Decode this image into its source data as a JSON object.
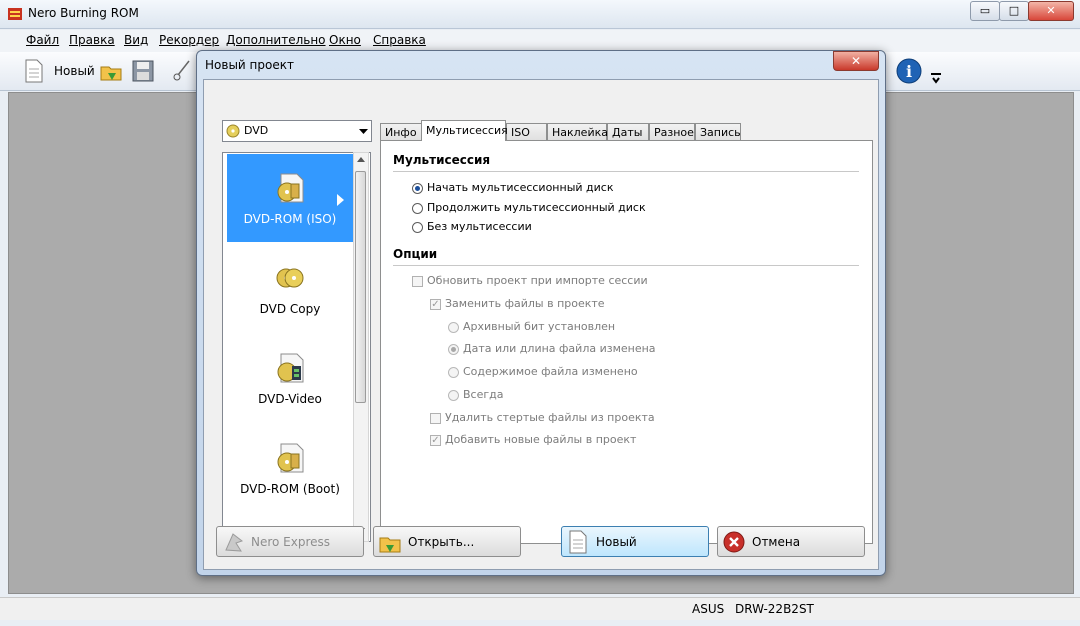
{
  "window": {
    "title": "Nero Burning ROM"
  },
  "window_controls": {
    "minimize": "▭",
    "maximize": "□",
    "close": "✕"
  },
  "menu": [
    "Файл",
    "Правка",
    "Вид",
    "Рекордер",
    "Дополнительно",
    "Окно",
    "Справка"
  ],
  "toolbar": {
    "new_label": "Новый",
    "info_icon": "i"
  },
  "statusbar": {
    "drive_vendor": "ASUS",
    "drive_model": "DRW-22B2ST"
  },
  "dialog": {
    "title": "Новый проект",
    "close_glyph": "✕",
    "disc_type": "DVD",
    "projects": [
      {
        "label": "DVD-ROM (ISO)",
        "icon": "dvd-rom-disc-icon",
        "selected": true
      },
      {
        "label": "DVD Copy",
        "icon": "dvd-copy-icon",
        "selected": false
      },
      {
        "label": "DVD-Video",
        "icon": "dvd-video-icon",
        "selected": false
      },
      {
        "label": "DVD-ROM (Boot)",
        "icon": "dvd-boot-icon",
        "selected": false
      }
    ],
    "tabs": [
      "Инфо",
      "Мультисессия",
      "ISO",
      "Наклейка",
      "Даты",
      "Разное",
      "Запись"
    ],
    "active_tab": "Мультисессия",
    "multisession": {
      "heading": "Мультисессия",
      "options": [
        {
          "label": "Начать мультисессионный диск",
          "checked": true
        },
        {
          "label": "Продолжить мультисессионный диск",
          "checked": false
        },
        {
          "label": "Без мультисессии",
          "checked": false
        }
      ]
    },
    "options": {
      "heading": "Опции",
      "update_project": "Обновить проект при импорте сессии",
      "replace_files": "Заменить файлы в проекте",
      "radio_archive": "Архивный бит установлен",
      "radio_date": "Дата или длина файла изменена",
      "radio_content": "Содержимое файла изменено",
      "radio_always": "Всегда",
      "delete_erased": "Удалить стертые файлы из проекта",
      "add_new": "Добавить новые файлы в проект"
    },
    "buttons": {
      "nero_express": "Nero Express",
      "open": "Открыть...",
      "new": "Новый",
      "cancel": "Отмена"
    }
  }
}
